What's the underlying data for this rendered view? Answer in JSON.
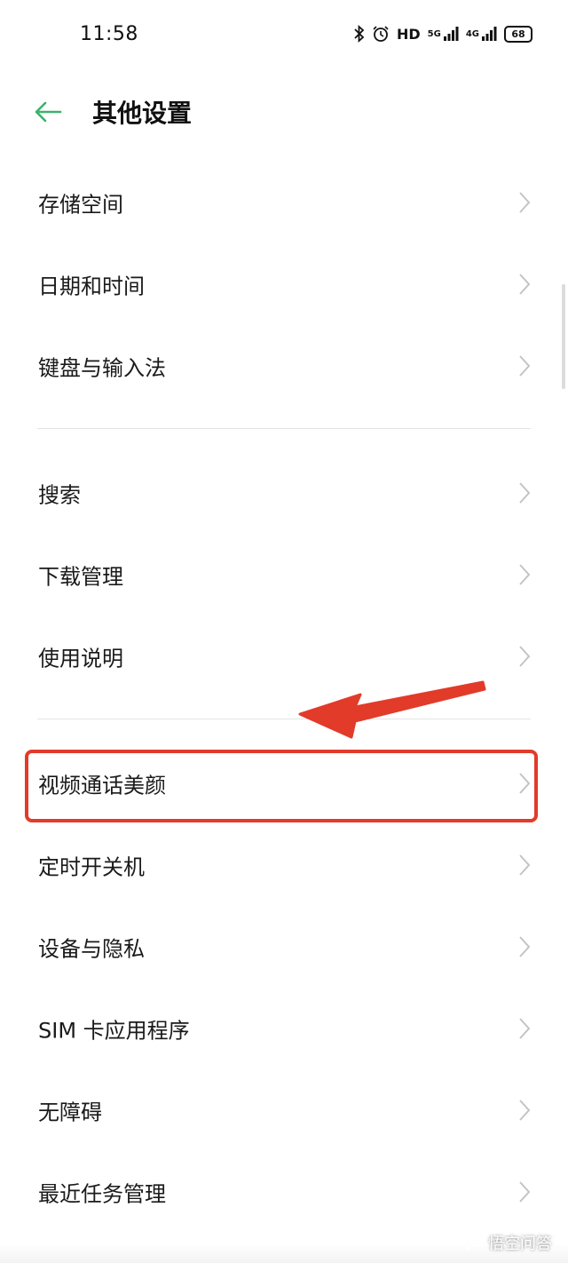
{
  "status_bar": {
    "time": "11:58",
    "bluetooth_icon": "bluetooth-icon",
    "alarm_icon": "alarm-icon",
    "hd_label": "HD",
    "signal_5g": "5G",
    "signal_4g": "4G",
    "battery_level": "68"
  },
  "header": {
    "back_icon": "arrow-left-icon",
    "title": "其他设置"
  },
  "settings": {
    "group1": [
      "存储空间",
      "日期和时间",
      "键盘与输入法"
    ],
    "group2": [
      "搜索",
      "下载管理",
      "使用说明"
    ],
    "group3": [
      "视频通话美颜",
      "定时开关机",
      "设备与隐私",
      "SIM 卡应用程序",
      "无障碍",
      "最近任务管理"
    ]
  },
  "annotation": {
    "highlighted_item": "视频通话美颜",
    "color": "#e23b2a"
  },
  "watermark": {
    "text": "悟空问答"
  },
  "colors": {
    "accent_green": "#3bb36b",
    "chevron": "#c4c4c4",
    "divider": "#e3e3e3"
  }
}
